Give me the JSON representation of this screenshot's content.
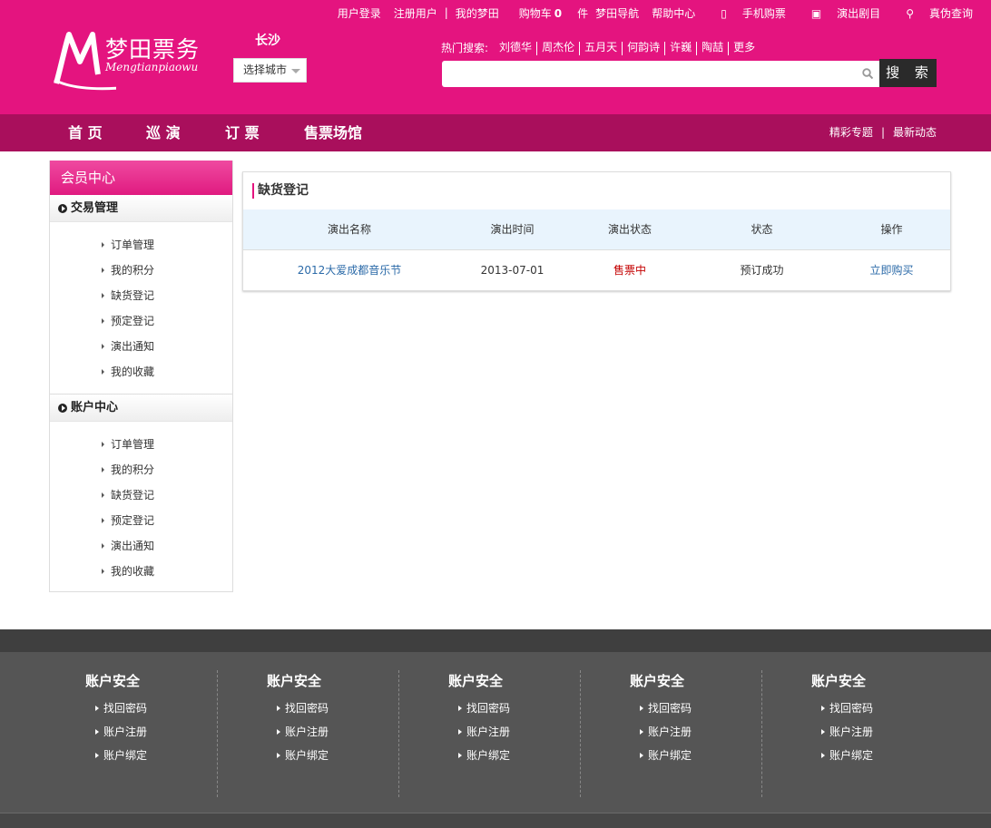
{
  "brand": {
    "name_cn": "梦田票务",
    "name_en": "Mengtianpiaowu",
    "accent": "#e4147f",
    "nav_bg": "#a90f5c"
  },
  "city": {
    "current": "长沙",
    "select_label": "选择城市"
  },
  "topnav": {
    "login": "用户登录",
    "register": "注册用户",
    "sep": "|",
    "my": "我的梦田",
    "cart_label": "购物车",
    "cart_count": "0",
    "cart_unit": "件",
    "guide": "梦田导航",
    "help": "帮助中心",
    "mobile": "手机购票",
    "shows": "演出剧目",
    "verify": "真伪查询"
  },
  "hot_search": {
    "label": "热门搜索:",
    "items": [
      "刘德华",
      "周杰伦",
      "五月天",
      "何韵诗",
      "许巍",
      "陶喆",
      "更多"
    ]
  },
  "search": {
    "placeholder": "",
    "button": "搜 索"
  },
  "mainnav": {
    "items": [
      "首 页",
      "巡 演",
      "订 票",
      "售票场馆"
    ],
    "right": [
      "精彩专题",
      "最新动态"
    ],
    "bar": "|"
  },
  "sidebar": {
    "title": "会员中心",
    "groups": [
      {
        "label": "交易管理",
        "items": [
          "订单管理",
          "我的积分",
          "缺货登记",
          "预定登记",
          "演出通知",
          "我的收藏"
        ]
      },
      {
        "label": "账户中心",
        "items": [
          "订单管理",
          "我的积分",
          "缺货登记",
          "预定登记",
          "演出通知",
          "我的收藏"
        ]
      }
    ]
  },
  "content": {
    "title": "缺货登记",
    "columns": [
      "演出名称",
      "演出时间",
      "演出状态",
      "状态",
      "操作"
    ],
    "rows": [
      {
        "name": "2012大爱成都音乐节",
        "date": "2013-07-01",
        "show_status": "售票中",
        "status": "预订成功",
        "action": "立即购买"
      }
    ]
  },
  "footer": {
    "columns": [
      {
        "title": "账户安全",
        "links": [
          "找回密码",
          "账户注册",
          "账户绑定"
        ]
      },
      {
        "title": "账户安全",
        "links": [
          "找回密码",
          "账户注册",
          "账户绑定"
        ]
      },
      {
        "title": "账户安全",
        "links": [
          "找回密码",
          "账户注册",
          "账户绑定"
        ]
      },
      {
        "title": "账户安全",
        "links": [
          "找回密码",
          "账户注册",
          "账户绑定"
        ]
      },
      {
        "title": "账户安全",
        "links": [
          "找回密码",
          "账户注册",
          "账户绑定"
        ]
      }
    ]
  }
}
